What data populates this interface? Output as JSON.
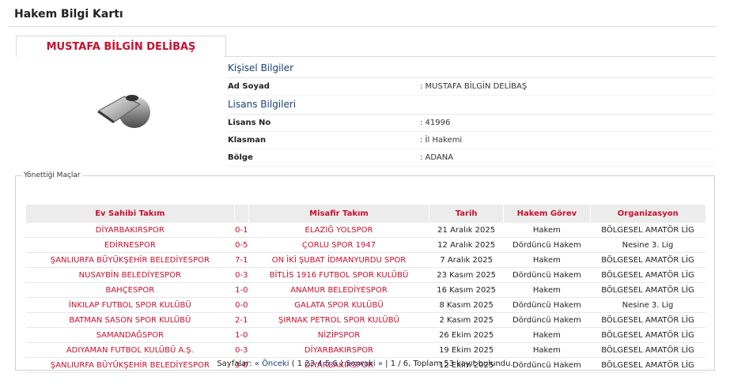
{
  "page": {
    "title": "Hakem Bilgi Kartı"
  },
  "referee": {
    "name": "MUSTAFA BİLGİN DELİBAŞ",
    "personal_section": "Kişisel Bilgiler",
    "name_label": "Ad Soyad",
    "name_value": ": MUSTAFA BİLGİN DELİBAŞ",
    "license_section": "Lisans Bilgileri",
    "license_no_label": "Lisans No",
    "license_no_value": ": 41996",
    "class_label": "Klasman",
    "class_value": ": İl Hakemi",
    "region_label": "Bölge",
    "region_value": ": ADANA"
  },
  "matches": {
    "legend": "Yönettiği Maçlar",
    "headers": {
      "home": "Ev Sahibi Takım",
      "score": "",
      "away": "Misafir Takım",
      "date": "Tarih",
      "role": "Hakem Görev",
      "org": "Organizasyon"
    },
    "rows": [
      {
        "home": "DİYARBAKIRSPOR",
        "score": "0-1",
        "away": "ELAZIĞ YOLSPOR",
        "date": "21 Aralık 2025",
        "role": "Hakem",
        "org": "BÖLGESEL AMATÖR LİG"
      },
      {
        "home": "EDİRNESPOR",
        "score": "0-5",
        "away": "ÇORLU SPOR 1947",
        "date": "12 Aralık 2025",
        "role": "Dördüncü Hakem",
        "org": "Nesine 3. Lig"
      },
      {
        "home": "ŞANLIURFA BÜYÜKŞEHİR BELEDİYESPOR",
        "score": "7-1",
        "away": "ON İKİ ŞUBAT İDMANYURDU SPOR",
        "date": "7 Aralık 2025",
        "role": "Hakem",
        "org": "BÖLGESEL AMATÖR LİG"
      },
      {
        "home": "NUSAYBİN BELEDİYESPOR",
        "score": "0-3",
        "away": "BİTLİS 1916 FUTBOL SPOR KULÜBÜ",
        "date": "23 Kasım 2025",
        "role": "Dördüncü Hakem",
        "org": "BÖLGESEL AMATÖR LİG"
      },
      {
        "home": "BAHÇESPOR",
        "score": "1-0",
        "away": "ANAMUR BELEDİYESPOR",
        "date": "16 Kasım 2025",
        "role": "Hakem",
        "org": "BÖLGESEL AMATÖR LİG"
      },
      {
        "home": "İNKILAP FUTBOL SPOR KULÜBÜ",
        "score": "0-0",
        "away": "GALATA SPOR KULÜBÜ",
        "date": "8 Kasım 2025",
        "role": "Dördüncü Hakem",
        "org": "Nesine 3. Lig"
      },
      {
        "home": "BATMAN SASON SPOR KULÜBÜ",
        "score": "2-1",
        "away": "ŞIRNAK PETROL SPOR KULÜBÜ",
        "date": "2 Kasım 2025",
        "role": "Dördüncü Hakem",
        "org": "BÖLGESEL AMATÖR LİG"
      },
      {
        "home": "SAMANDAĞSPOR",
        "score": "1-0",
        "away": "NİZİPSPOR",
        "date": "26 Ekim 2025",
        "role": "Hakem",
        "org": "BÖLGESEL AMATÖR LİG"
      },
      {
        "home": "ADIYAMAN FUTBOL KULÜBÜ A.Ş.",
        "score": "0-3",
        "away": "DİYARBAKIRSPOR",
        "date": "19 Ekim 2025",
        "role": "Hakem",
        "org": "BÖLGESEL AMATÖR LİG"
      },
      {
        "home": "ŞANLIURFA BÜYÜKŞEHİR BELEDİYESPOR",
        "score": "3-0",
        "away": "DİYARBAKIRSPOR",
        "date": "12 Ekim 2025",
        "role": "Dördüncü Hakem",
        "org": "BÖLGESEL AMATÖR LİG"
      }
    ]
  },
  "pager": {
    "label": "Sayfalar:",
    "prev": "« Önceki",
    "open_paren": "(",
    "pages": [
      "1",
      "2",
      "3",
      "4",
      "5",
      "6"
    ],
    "close_paren": ")",
    "next": "Sonraki »",
    "summary": "| 1 / 6, Toplam 53 kayıt bulundu."
  },
  "icons": {
    "avatar": "whistle-icon"
  },
  "colors": {
    "accent_red": "#c8102e",
    "section_blue": "#1b3d7a",
    "header_bg": "#ececec"
  }
}
